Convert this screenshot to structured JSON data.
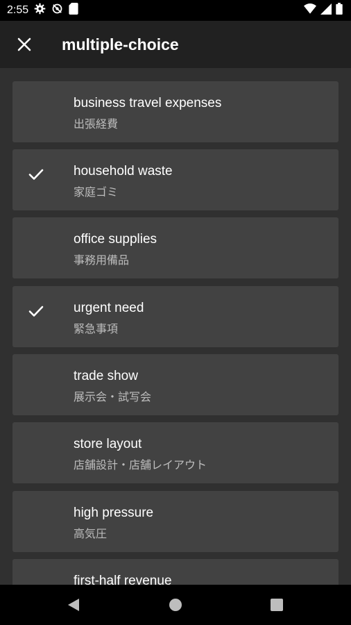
{
  "status_bar": {
    "time": "2:55",
    "left_icons": [
      "settings-icon",
      "sync-disabled-icon",
      "sd-card-icon"
    ],
    "right_icons": [
      "wifi-icon",
      "signal-icon",
      "battery-icon"
    ]
  },
  "app_bar": {
    "title": "multiple-choice",
    "close_icon": "close-icon"
  },
  "items": [
    {
      "title": "business travel expenses",
      "subtitle": "出張経費",
      "checked": false
    },
    {
      "title": "household waste",
      "subtitle": "家庭ゴミ",
      "checked": true
    },
    {
      "title": "office supplies",
      "subtitle": "事務用備品",
      "checked": false
    },
    {
      "title": "urgent need",
      "subtitle": "緊急事項",
      "checked": true
    },
    {
      "title": "trade show",
      "subtitle": "展示会・試写会",
      "checked": false
    },
    {
      "title": "store layout",
      "subtitle": "店舗設計・店舗レイアウト",
      "checked": false
    },
    {
      "title": "high pressure",
      "subtitle": "高気圧",
      "checked": false
    },
    {
      "title": "first-half revenue",
      "subtitle": "",
      "checked": false
    }
  ],
  "nav_bar": {
    "icons": [
      "back-icon",
      "home-icon",
      "recents-icon"
    ]
  },
  "colors": {
    "background": "#303030",
    "card": "#424242",
    "app_bar": "#212121",
    "subtitle": "#bdbdbd"
  }
}
